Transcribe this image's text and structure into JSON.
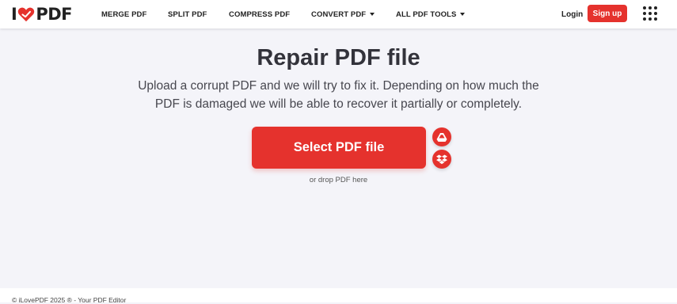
{
  "brand": {
    "logo_left": "I",
    "logo_right": "PDF",
    "accent_color": "#e5322d",
    "logo_icon": "heart-icon"
  },
  "nav": {
    "items": [
      {
        "label": "MERGE PDF"
      },
      {
        "label": "SPLIT PDF"
      },
      {
        "label": "COMPRESS PDF"
      },
      {
        "label": "CONVERT PDF",
        "dropdown": true
      },
      {
        "label": "ALL PDF TOOLS",
        "dropdown": true
      }
    ],
    "login": "Login",
    "signup": "Sign up",
    "apps_icon": "grid-menu-icon"
  },
  "main": {
    "title": "Repair PDF file",
    "subtitle_line1": "Upload a corrupt PDF and we will try to fix it. Depending on how much the",
    "subtitle_line2": "PDF is damaged we will be able to recover it partially or completely.",
    "select_button": "Select PDF file",
    "cloud_buttons": [
      "google-drive-icon",
      "dropbox-icon"
    ],
    "drop_hint": "or drop PDF here"
  },
  "footer": {
    "text": "© iLovePDF 2025 ® - Your PDF Editor"
  }
}
